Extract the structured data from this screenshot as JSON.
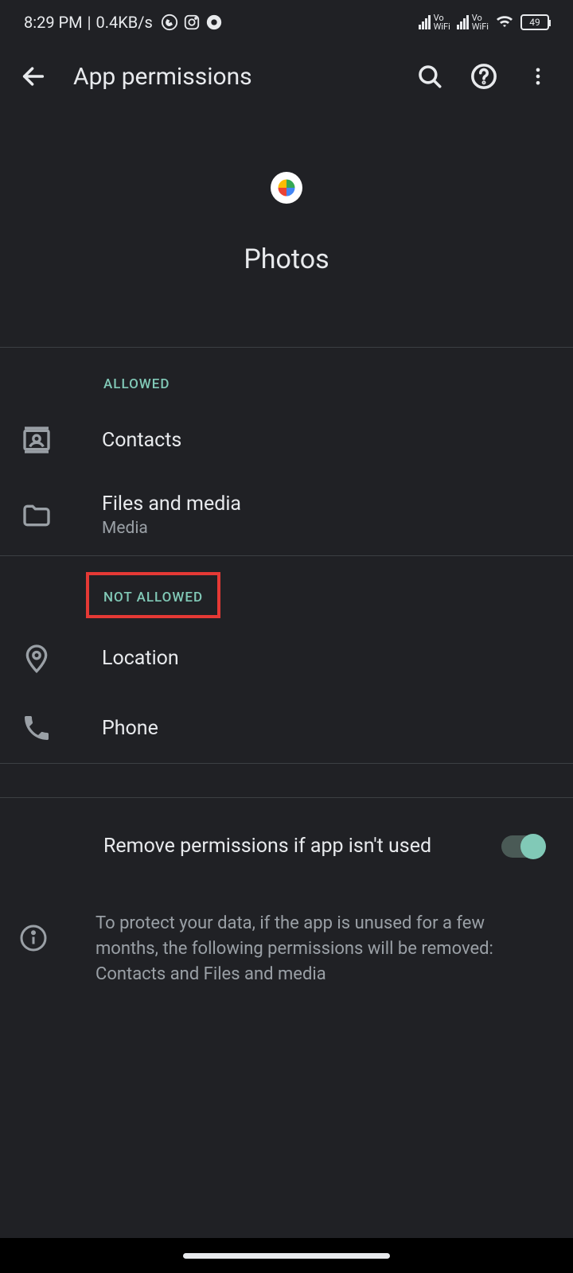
{
  "status": {
    "time": "8:29 PM",
    "speed": "0.4KB/s",
    "battery": "49",
    "vo1": "Vo",
    "wifi1": "WiFi",
    "vo2": "Vo",
    "wifi2": "WiFi"
  },
  "appBar": {
    "title": "App permissions"
  },
  "app": {
    "name": "Photos"
  },
  "sections": {
    "allowed": "ALLOWED",
    "notAllowed": "NOT ALLOWED"
  },
  "permissions": {
    "allowed": [
      {
        "label": "Contacts",
        "sub": ""
      },
      {
        "label": "Files and media",
        "sub": "Media"
      }
    ],
    "notAllowed": [
      {
        "label": "Location",
        "sub": ""
      },
      {
        "label": "Phone",
        "sub": ""
      }
    ]
  },
  "remove": {
    "label": "Remove permissions if app isn't used"
  },
  "info": {
    "text": "To protect your data, if the app is unused for a few months, the following permissions will be removed: Contacts and Files and media"
  }
}
